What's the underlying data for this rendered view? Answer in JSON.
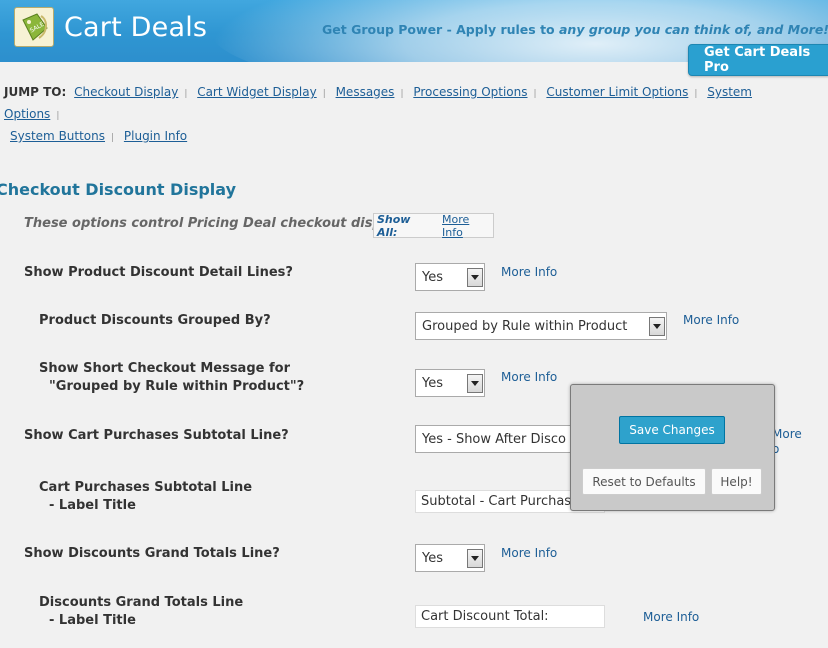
{
  "header": {
    "title": "Cart Deals",
    "tagline_main": "Get Group Power  -  Apply rules to ",
    "tagline_em": "any group you can think of",
    "tagline_end": ", and More!",
    "pro_button": "Get Cart Deals Pro",
    "brand_color": "#2f96d2"
  },
  "jump": {
    "label": "JUMP TO:",
    "links": [
      "Checkout Display",
      "Cart Widget Display",
      "Messages",
      "Processing Options",
      "Customer Limit Options",
      "System Options",
      "System Buttons",
      "Plugin Info"
    ],
    "separator": "|"
  },
  "section": {
    "title": "Checkout Discount Display",
    "intro": "These options control Pricing Deal checkout display.",
    "show_all": "Show All:",
    "show_all_more": "More Info"
  },
  "rows": {
    "r1": {
      "label": "Show Product Discount Detail Lines?",
      "value": "Yes",
      "more": "More Info"
    },
    "r2": {
      "label": "Product Discounts Grouped By?",
      "value": "Grouped by Rule within Product",
      "more": "More Info"
    },
    "r3": {
      "label_a": "Show Short Checkout Message for",
      "label_b": "\"Grouped by Rule within Product\"?",
      "value": "Yes",
      "more": "More Info"
    },
    "r4": {
      "label": "Show Cart Purchases Subtotal Line?",
      "value": "Yes - Show  After Disco",
      "more_a": "More",
      "more_b": "o"
    },
    "r5": {
      "label_a": "Cart Purchases Subtotal Line",
      "label_b": "- Label Title",
      "value": "Subtotal - Cart Purchas"
    },
    "r6": {
      "label": "Show Discounts Grand Totals Line?",
      "value": "Yes",
      "more": "More Info"
    },
    "r7": {
      "label_a": "Discounts Grand Totals Line",
      "label_b": "- Label Title",
      "value": "Cart Discount Total:",
      "more": "More Info"
    }
  },
  "panel": {
    "save": "Save Changes",
    "reset": "Reset to Defaults",
    "help": "Help!"
  }
}
